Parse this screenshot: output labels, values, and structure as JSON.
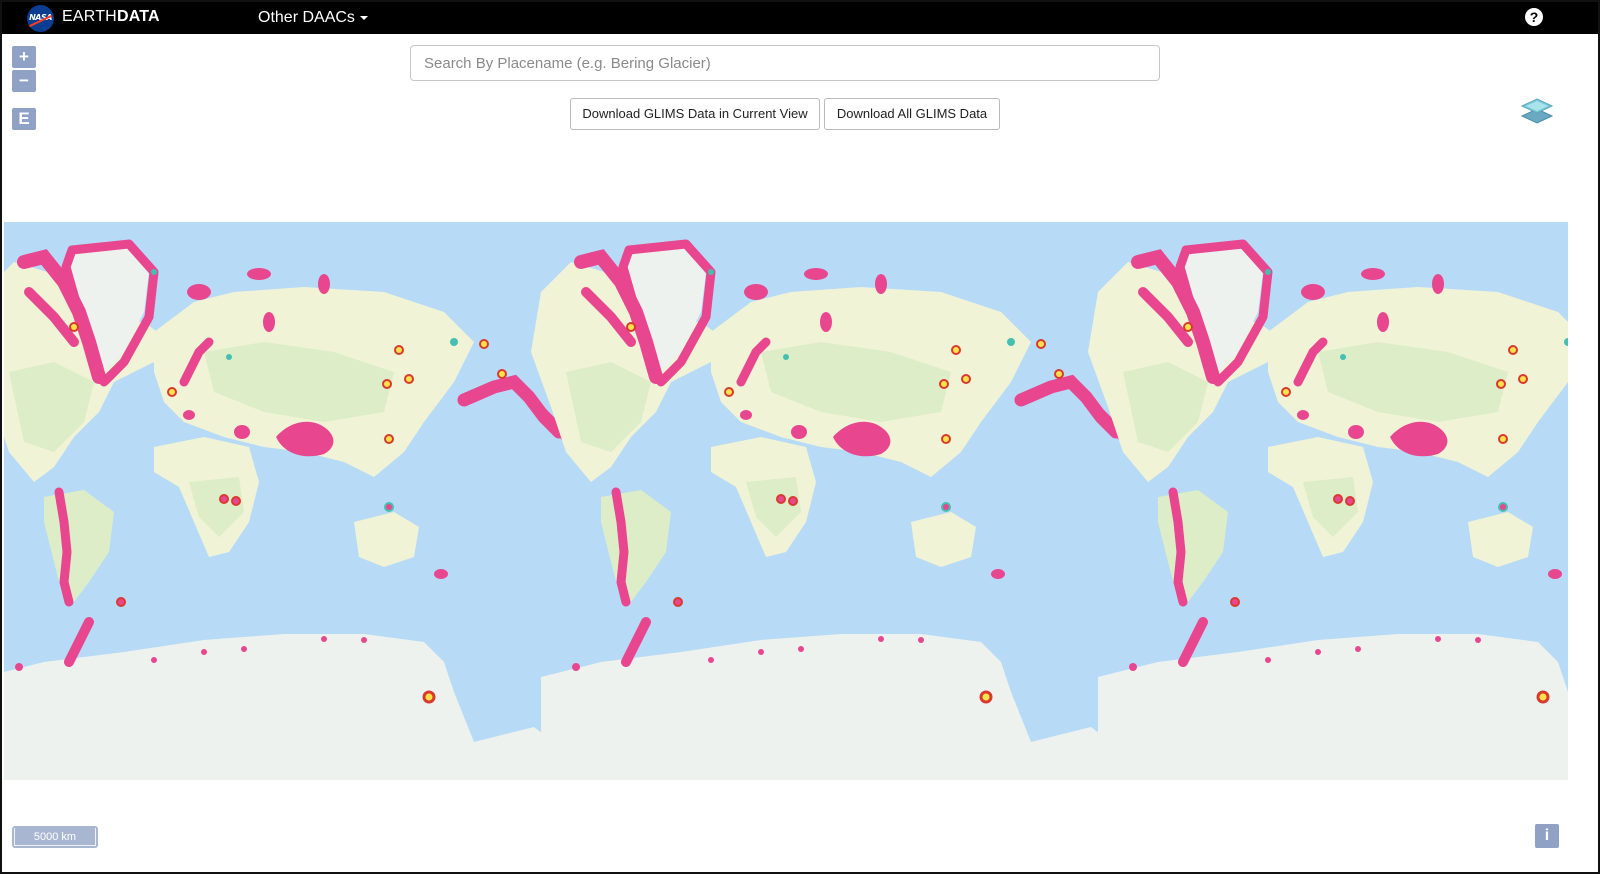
{
  "header": {
    "logo_text": "NASA",
    "brand_light": "EARTH",
    "brand_bold": "DATA",
    "menu_label": "Other DAACs",
    "help_symbol": "?"
  },
  "map_controls": {
    "zoom_in": "+",
    "zoom_out": "−",
    "extent": "E"
  },
  "search": {
    "placeholder": "Search By Placename (e.g. Bering Glacier)",
    "value": ""
  },
  "buttons": {
    "download_current": "Download GLIMS Data in Current View",
    "download_all": "Download All GLIMS Data"
  },
  "layer_switcher_icon": "layers-icon",
  "map": {
    "projection": "world map repeated three times horizontally",
    "colors": {
      "ocean": "#b7dbf7",
      "land": "#f1f3d6",
      "vegetation": "#dcedc8",
      "ice_sheet": "#eef2ee",
      "glacier": "#e8478f",
      "glacier_outline": "#d93a30",
      "glacier_highlight": "#ffe24a",
      "teal_markers": "#45c0b0"
    }
  },
  "scale_bar": {
    "label": "5000 km"
  },
  "info_symbol": "i"
}
